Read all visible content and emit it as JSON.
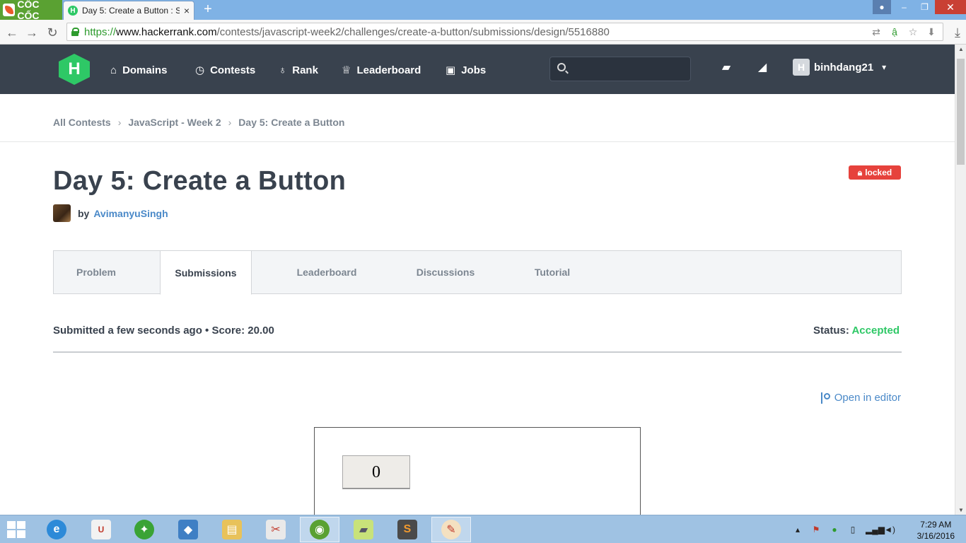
{
  "browser": {
    "brand": "CỐC CỐC",
    "tab_title": "Day 5: Create a Button : Submissions",
    "tab_favicon": "H",
    "url_scheme": "https://",
    "url_host": "www.hackerrank.com",
    "url_path": "/contests/javascript-week2/challenges/create-a-button/submissions/design/5516880"
  },
  "nav": {
    "logo": "H",
    "items": [
      {
        "label": "Domains",
        "icon": "home-icon",
        "glyph": "⌂"
      },
      {
        "label": "Contests",
        "icon": "clock-icon",
        "glyph": "◷"
      },
      {
        "label": "Rank",
        "icon": "medal-icon",
        "glyph": "♁"
      },
      {
        "label": "Leaderboard",
        "icon": "trophy-icon",
        "glyph": "♕"
      },
      {
        "label": "Jobs",
        "icon": "briefcase-icon",
        "glyph": "▣"
      }
    ],
    "search_placeholder": "",
    "username": "binhdang21",
    "avatar_letter": "H"
  },
  "breadcrumb": {
    "items": [
      "All Contests",
      "JavaScript - Week 2",
      "Day 5: Create a Button"
    ]
  },
  "challenge": {
    "title": "Day 5: Create a Button",
    "locked_label": "locked",
    "by_label": "by",
    "author": "AvimanyuSingh"
  },
  "tabs": {
    "items": [
      "Problem",
      "Submissions",
      "Leaderboard",
      "Discussions",
      "Tutorial"
    ],
    "active": "Submissions"
  },
  "submission": {
    "info": "Submitted a few seconds ago • Score: 20.00",
    "status_label": "Status:",
    "status_value": "Accepted",
    "open_editor": "Open in editor",
    "preview_button": "0"
  },
  "taskbar": {
    "time": "7:29 AM",
    "date": "3/16/2016"
  },
  "colors": {
    "nav_bg": "#39424e",
    "accent_green": "#2ec866",
    "link_blue": "#4a89c8",
    "locked_red": "#e6423c",
    "taskbar": "#9fc2e3"
  }
}
